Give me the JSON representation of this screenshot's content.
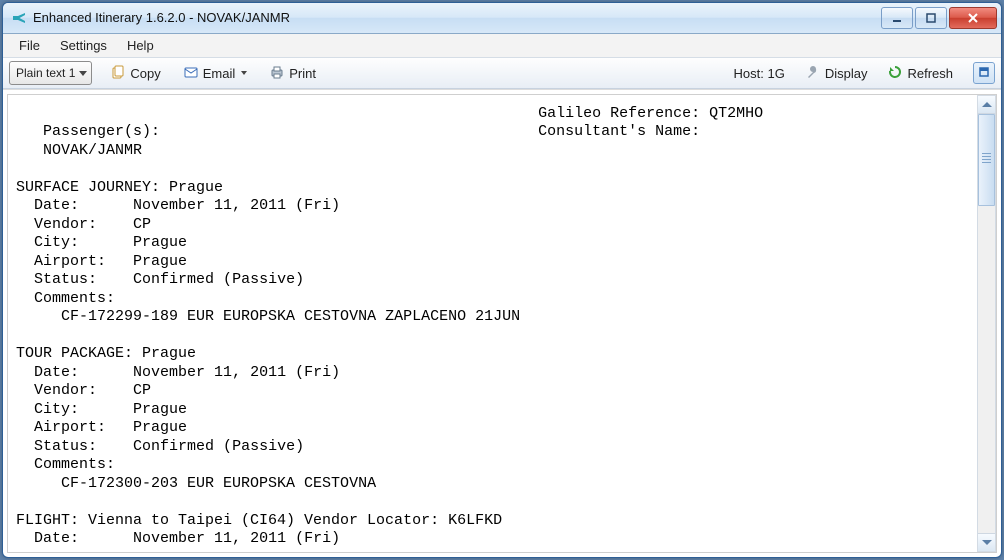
{
  "window": {
    "title": "Enhanced Itinerary 1.6.2.0 - NOVAK/JANMR"
  },
  "menu": {
    "file": "File",
    "settings": "Settings",
    "help": "Help"
  },
  "toolbar": {
    "format_selector": "Plain text 1",
    "copy": "Copy",
    "email": "Email",
    "print": "Print",
    "host_label": "Host: 1G",
    "display": "Display",
    "refresh": "Refresh"
  },
  "itinerary": {
    "ref_label": "Galileo Reference:",
    "ref_value": "QT2MHO",
    "consultant_label": "Consultant's Name:",
    "consultant_value": "",
    "passenger_label": "Passenger(s):",
    "passenger_name": "NOVAK/JANMR",
    "segments": [
      {
        "header": "SURFACE JOURNEY: Prague",
        "date": "November 11, 2011 (Fri)",
        "vendor": "CP",
        "city": "Prague",
        "airport": "Prague",
        "status": "Confirmed (Passive)",
        "comment": "CF-172299-189 EUR EUROPSKA CESTOVNA ZAPLACENO 21JUN"
      },
      {
        "header": "TOUR PACKAGE: Prague",
        "date": "November 11, 2011 (Fri)",
        "vendor": "CP",
        "city": "Prague",
        "airport": "Prague",
        "status": "Confirmed (Passive)",
        "comment": "CF-172300-203 EUR EUROPSKA CESTOVNA"
      }
    ],
    "flight_header": "FLIGHT: Vienna to Taipei (CI64) Vendor Locator: K6LFKD",
    "flight_date": "November 11, 2011 (Fri)"
  },
  "labels": {
    "date": "Date:",
    "vendor": "Vendor:",
    "city": "City:",
    "airport": "Airport:",
    "status": "Status:",
    "comments": "Comments:"
  }
}
